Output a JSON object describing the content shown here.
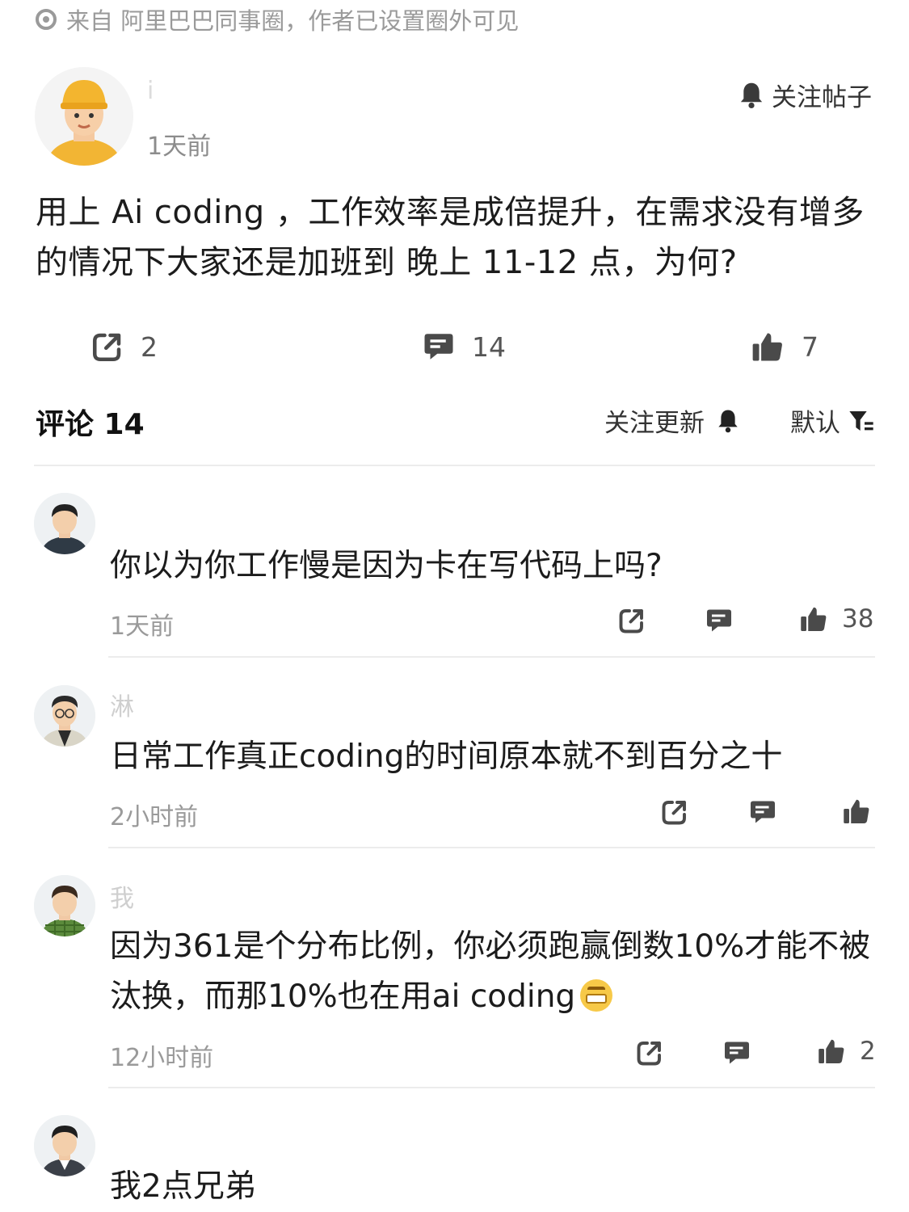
{
  "source": {
    "text": "来自 阿里巴巴同事圈，作者已设置圈外可见"
  },
  "post": {
    "author_initial": "i",
    "time": "1天前",
    "follow_label": "关注帖子",
    "body": "用上 Ai coding ，工作效率是成倍提升，在需求没有增多的情况下大家还是加班到 晚上 11-12 点，为何?",
    "stats": {
      "share": "2",
      "comments": "14",
      "likes": "7"
    }
  },
  "comments_header": {
    "title": "评论 14",
    "follow_updates": "关注更新",
    "sort": "默认"
  },
  "comments": [
    {
      "name": "",
      "text": "你以为你工作慢是因为卡在写代码上吗?",
      "time": "1天前",
      "likes": "38"
    },
    {
      "name": "淋",
      "text": "日常工作真正coding的时间原本就不到百分之十",
      "time": "2小时前",
      "likes": ""
    },
    {
      "name": "我",
      "text": "因为361是个分布比例，你必须跑赢倒数10%才能不被汰换，而那10%也在用ai coding",
      "time": "12小时前",
      "likes": "2"
    },
    {
      "name": "",
      "text": "我2点兄弟",
      "time": "",
      "likes": ""
    }
  ],
  "colors": {
    "icon": "#4a4a4a",
    "muted": "#9a9a9a",
    "text": "#1c1c1c"
  },
  "icons": [
    "radio-dot-icon",
    "bell-icon",
    "share-icon",
    "comment-icon",
    "thumbs-up-icon",
    "filter-icon",
    "grin-emoji-icon"
  ]
}
